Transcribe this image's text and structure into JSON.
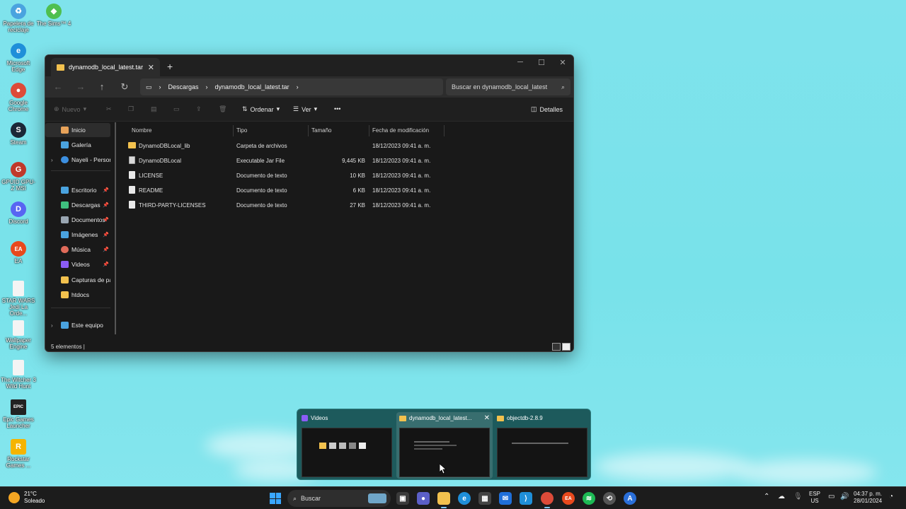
{
  "desktop": {
    "icons": [
      {
        "label": "Papelera de reciclaje",
        "color": "#4aa3df",
        "glyph": "♻"
      },
      {
        "label": "The Sims™ 4",
        "color": "#4fbf4f",
        "glyph": "◆"
      },
      {
        "label": "Microsoft Edge",
        "color": "#1f8fd9",
        "glyph": "e"
      },
      {
        "label": "Google Chrome",
        "color": "#dd4b39",
        "glyph": "●"
      },
      {
        "label": "Steam",
        "color": "#1b2838",
        "glyph": "S"
      },
      {
        "label": "GPUID GPU-Z MSI",
        "color": "#c0392b",
        "glyph": "G"
      },
      {
        "label": "Discord",
        "color": "#5865f2",
        "glyph": "D"
      },
      {
        "label": "EA",
        "color": "#e8491d",
        "glyph": "EA"
      },
      {
        "label": "STAR WARS Jedi La Orde...",
        "color": "#f4f4f4",
        "glyph": ""
      },
      {
        "label": "Wallpaper Engine",
        "color": "#f4f4f4",
        "glyph": ""
      },
      {
        "label": "The Witcher 3 Wild Hunt",
        "color": "#f4f4f4",
        "glyph": ""
      },
      {
        "label": "Epic Games Launcher",
        "color": "#222222",
        "glyph": "EPIC"
      },
      {
        "label": "Rockstar Games ...",
        "color": "#f5b400",
        "glyph": "R"
      }
    ]
  },
  "explorer": {
    "tab_title": "dynamodb_local_latest.tar",
    "new_tab": "+",
    "breadcrumb": [
      "Descargas",
      "dynamodb_local_latest.tar"
    ],
    "search_placeholder": "Buscar en dynamodb_local_latest",
    "toolbar": {
      "new": "Nuevo",
      "sort": "Ordenar",
      "view": "Ver",
      "more": "•••",
      "details": "Detalles"
    },
    "sidebar": [
      {
        "label": "Inicio",
        "color": "#e8a35a",
        "pinned": false,
        "expandable": false
      },
      {
        "label": "Galería",
        "color": "#4aa3df",
        "pinned": false,
        "expandable": false
      },
      {
        "label": "Nayeli - Persona",
        "color": "#3c8fe0",
        "pinned": false,
        "expandable": true
      },
      {
        "label": "Escritorio",
        "color": "#4aa3df",
        "pinned": true,
        "expandable": false
      },
      {
        "label": "Descargas",
        "color": "#3fbf7f",
        "pinned": true,
        "expandable": false
      },
      {
        "label": "Documentos",
        "color": "#9aa6b2",
        "pinned": true,
        "expandable": false
      },
      {
        "label": "Imágenes",
        "color": "#4aa3df",
        "pinned": true,
        "expandable": false
      },
      {
        "label": "Música",
        "color": "#e06b5a",
        "pinned": true,
        "expandable": false
      },
      {
        "label": "Videos",
        "color": "#8b5cf6",
        "pinned": true,
        "expandable": false
      },
      {
        "label": "Capturas de par",
        "color": "#f2c14e",
        "pinned": false,
        "expandable": false
      },
      {
        "label": "htdocs",
        "color": "#f2c14e",
        "pinned": false,
        "expandable": false
      },
      {
        "label": "Este equipo",
        "color": "#4aa3df",
        "pinned": false,
        "expandable": true
      }
    ],
    "columns": [
      "Nombre",
      "Tipo",
      "Tamaño",
      "Fecha de modificación"
    ],
    "files": [
      {
        "name": "DynamoDBLocal_lib",
        "type": "Carpeta de archivos",
        "size": "",
        "date": "18/12/2023 09:41 a. m.",
        "kind": "folder"
      },
      {
        "name": "DynamoDBLocal",
        "type": "Executable Jar File",
        "size": "9,445 KB",
        "date": "18/12/2023 09:41 a. m.",
        "kind": "jar"
      },
      {
        "name": "LICENSE",
        "type": "Documento de texto",
        "size": "10 KB",
        "date": "18/12/2023 09:41 a. m.",
        "kind": "file"
      },
      {
        "name": "README",
        "type": "Documento de texto",
        "size": "6 KB",
        "date": "18/12/2023 09:41 a. m.",
        "kind": "file"
      },
      {
        "name": "THIRD-PARTY-LICENSES",
        "type": "Documento de texto",
        "size": "27 KB",
        "date": "18/12/2023 09:41 a. m.",
        "kind": "file"
      }
    ],
    "status": "5 elementos  |"
  },
  "preview": {
    "windows": [
      {
        "title": "Videos",
        "icon_color": "#8b5cf6",
        "selected": false
      },
      {
        "title": "dynamodb_local_latest...",
        "icon_color": "#f2c14e",
        "selected": true
      },
      {
        "title": "objectdb-2.8.9",
        "icon_color": "#f2c14e",
        "selected": false
      }
    ],
    "close": "✕"
  },
  "taskbar": {
    "weather_temp": "21°C",
    "weather_desc": "Soleado",
    "search_placeholder": "Buscar",
    "lang_top": "ESP",
    "lang_bottom": "US",
    "time": "04:37 p. m.",
    "date": "28/01/2024"
  }
}
